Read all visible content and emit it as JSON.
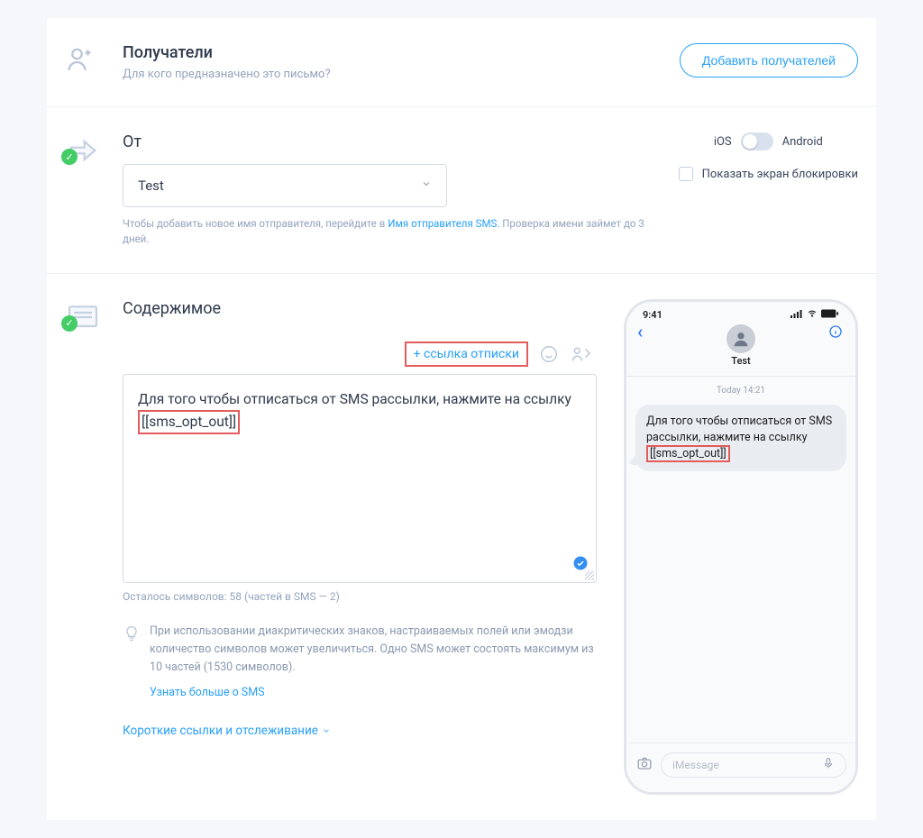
{
  "recipients": {
    "heading": "Получатели",
    "subtext": "Для кого предназначено это письмо?",
    "add_button": "Добавить получателей"
  },
  "from": {
    "label": "От",
    "select_value": "Test",
    "help_prefix": "Чтобы добавить новое имя отправителя, перейдите в",
    "help_link": "Имя отправителя SMS.",
    "help_suffix": "Проверка имени займет до 3 дней.",
    "os_ios": "iOS",
    "os_android": "Android",
    "lockscreen_label": "Показать экран блокировки"
  },
  "content": {
    "heading": "Содержимое",
    "unsub_link": "+ ссылка отписки",
    "message_prefix": "Для того чтобы отписаться от SMS рассылки, нажмите на ссылку ",
    "message_token": "[[sms_opt_out]]",
    "counter": "Осталось символов: 58 (частей в SMS — 2)",
    "hint_text": "При использовании диакритических знаков, настраиваемых полей или эмодзи количество символов может увеличиться. Одно SMS может состоять максимум из 10 частей (1530 символов).",
    "hint_link": "Узнать больше о SMS",
    "short_links": "Короткие ссылки и отслеживание"
  },
  "phone": {
    "time": "9:41",
    "contact_name": "Test",
    "timestamp": "Today 14:21",
    "bubble_prefix": "Для того чтобы отписаться от SMS рассылки, нажмите на ссылку ",
    "bubble_token": "[[sms_opt_out]]",
    "input_placeholder": "iMessage"
  }
}
